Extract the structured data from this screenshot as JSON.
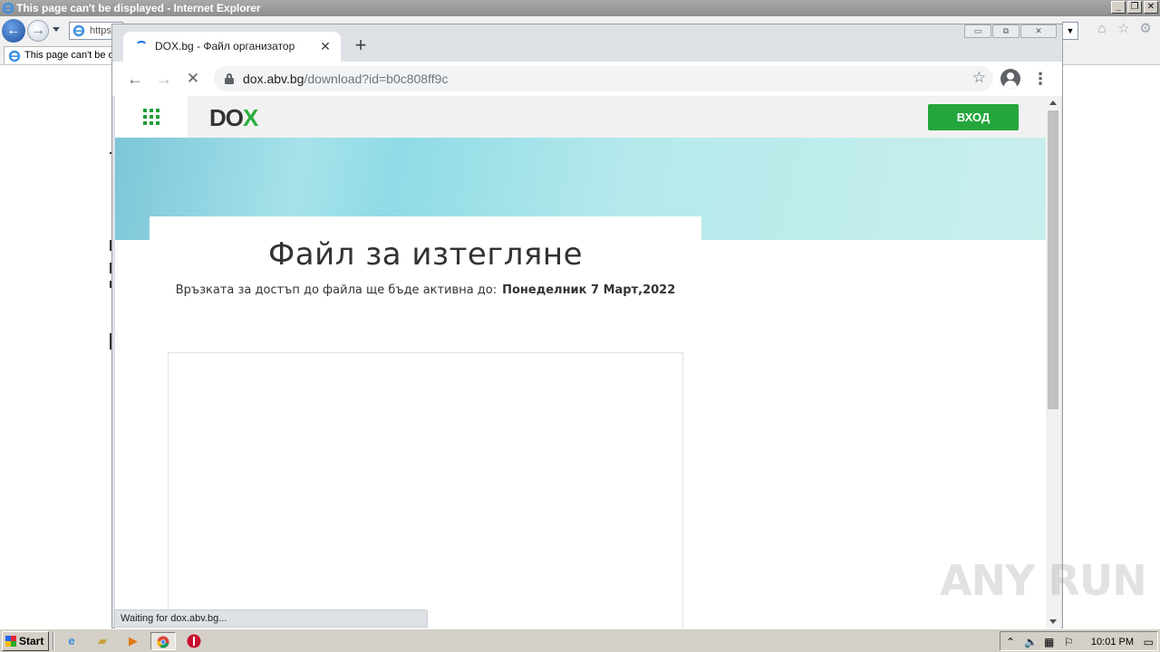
{
  "ie": {
    "title": "This page can't be displayed - Internet Explorer",
    "address_text": "https",
    "tab_label": "This page can't be d",
    "window_buttons": [
      "_",
      "❐",
      "✕"
    ],
    "tool_icons": [
      "home-icon",
      "star-icon",
      "gear-icon"
    ]
  },
  "chrome": {
    "tab_title": "DOX.bg - Файл организатор",
    "tab_close": "✕",
    "new_tab": "+",
    "window_buttons": {
      "minimize": "▭",
      "restore": "⧉",
      "close": "✕"
    },
    "url_host": "dox.abv.bg",
    "url_path": "/download?id=b0c808ff9c",
    "status_text": "Waiting for dox.abv.bg..."
  },
  "site": {
    "logo_main": "DO",
    "logo_accent": "X",
    "login_label": "ВХОД",
    "card_title": "Файл за изтегляне",
    "card_subtitle": "Връзката за достъп до файла ще бъде активна до:",
    "card_date": "Понеделник 7 Март,2022"
  },
  "watermark": "ANY RUN",
  "taskbar": {
    "start_label": "Start",
    "clock": "10:01 PM"
  }
}
